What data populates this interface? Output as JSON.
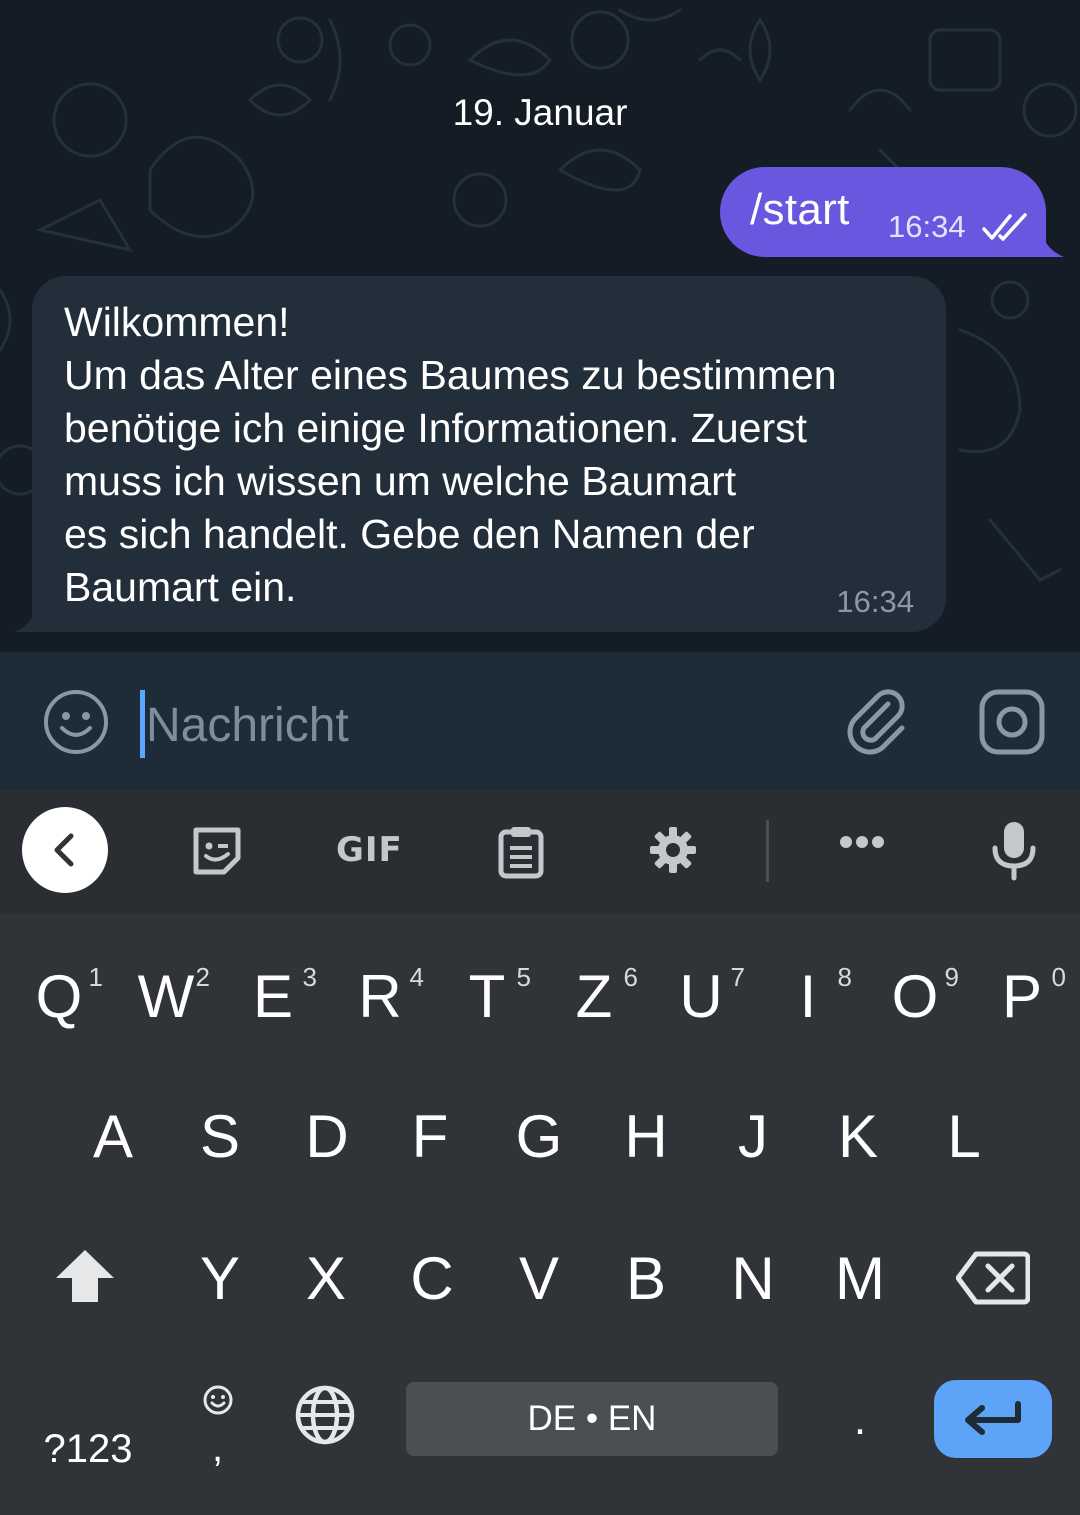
{
  "chat": {
    "date": "19. Januar",
    "outgoing": {
      "text": "/start",
      "time": "16:34",
      "status": "read"
    },
    "incoming": {
      "text": "Wilkommen!\nUm das Alter eines Baumes zu bestimmen\nbenötige ich einige Informationen. Zuerst\nmuss ich wissen um welche Baumart\nes sich handelt. Gebe den Namen der\nBaumart ein.",
      "time": "16:34"
    }
  },
  "input": {
    "placeholder": "Nachricht",
    "value": ""
  },
  "keyboard": {
    "toolbar": {
      "gif_label": "GIF"
    },
    "row1": [
      {
        "key": "Q",
        "hint": "1"
      },
      {
        "key": "W",
        "hint": "2"
      },
      {
        "key": "E",
        "hint": "3"
      },
      {
        "key": "R",
        "hint": "4"
      },
      {
        "key": "T",
        "hint": "5"
      },
      {
        "key": "Z",
        "hint": "6"
      },
      {
        "key": "U",
        "hint": "7"
      },
      {
        "key": "I",
        "hint": "8"
      },
      {
        "key": "O",
        "hint": "9"
      },
      {
        "key": "P",
        "hint": "0"
      }
    ],
    "row2": [
      "A",
      "S",
      "D",
      "F",
      "G",
      "H",
      "J",
      "K",
      "L"
    ],
    "row3": [
      "Y",
      "X",
      "C",
      "V",
      "B",
      "N",
      "M"
    ],
    "symbols_label": "?123",
    "comma_label": ",",
    "space_label": "DE • EN",
    "period_label": "."
  },
  "colors": {
    "outgoing_bubble": "#6a57e0",
    "incoming_bubble": "#222e3a",
    "chat_background": "#141c26",
    "input_bar": "#1e2c3a",
    "keyboard_background": "#303438",
    "enter_key": "#5da3f7"
  },
  "icons": {
    "emoji_button": "smiley-icon",
    "attach_button": "paperclip-icon",
    "camera_button": "instagram-camera-icon",
    "toolbar": [
      "chevron-left-icon",
      "sticker-icon",
      "gif-icon",
      "clipboard-icon",
      "gear-icon",
      "more-icon",
      "microphone-icon"
    ],
    "shift": "shift-icon",
    "backspace": "backspace-icon",
    "globe": "globe-icon",
    "enter": "enter-icon",
    "read_receipt": "double-check-icon"
  }
}
